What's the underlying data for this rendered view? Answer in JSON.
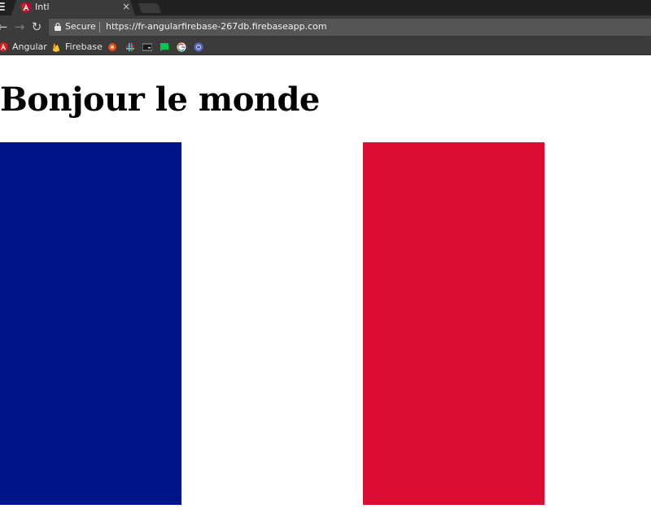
{
  "browser": {
    "tab": {
      "title": "Intl",
      "close": "×"
    },
    "toolbar": {
      "secure_label": "Secure",
      "url": "https://fr-angularfirebase-267db.firebaseapp.com"
    },
    "bookmarks": [
      {
        "label": "Angular",
        "icon": "angular-icon"
      },
      {
        "label": "Firebase",
        "icon": "firebase-icon"
      },
      {
        "label": "",
        "icon": "bookmark-icon"
      },
      {
        "label": "",
        "icon": "slack-icon"
      },
      {
        "label": "",
        "icon": "terminal-icon"
      },
      {
        "label": "",
        "icon": "chat-icon"
      },
      {
        "label": "",
        "icon": "google-icon"
      },
      {
        "label": "",
        "icon": "chromium-icon"
      }
    ]
  },
  "page": {
    "heading": "Bonjour le monde",
    "flag": {
      "stripes": [
        {
          "color": "#001489"
        },
        {
          "color": "#ffffff"
        },
        {
          "color": "#dc0d35"
        }
      ]
    }
  },
  "colors": {
    "angular_red": "#dd1b16",
    "firebase_yellow": "#ffca28",
    "flag_blue": "#001489",
    "flag_red": "#dc0d35"
  }
}
